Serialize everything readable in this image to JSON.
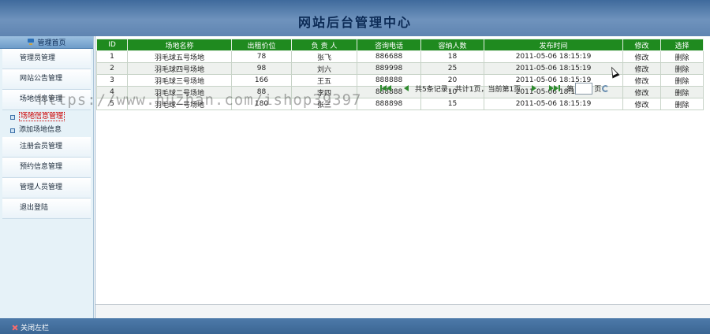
{
  "header": {
    "title": "网站后台管理中心"
  },
  "sidebar": {
    "home_label": "管理首页",
    "items": [
      {
        "label": "管理员管理"
      },
      {
        "label": "网站公告管理"
      },
      {
        "label": "场地信息管理"
      }
    ],
    "subitems": [
      {
        "label": "场地信息管理",
        "active": true
      },
      {
        "label": "添加场地信息",
        "active": false
      }
    ],
    "items2": [
      {
        "label": "注册会员管理"
      },
      {
        "label": "预约信息管理"
      },
      {
        "label": "管理人员管理"
      },
      {
        "label": "退出登陆"
      }
    ]
  },
  "table": {
    "columns": [
      "ID",
      "场地名称",
      "出租价位",
      "负 责 人",
      "咨询电话",
      "容纳人数",
      "发布时间",
      "修改",
      "选择"
    ],
    "rows": [
      [
        "1",
        "羽毛球五号场地",
        "78",
        "张飞",
        "886688",
        "18",
        "2011-05-06 18:15:19",
        "修改",
        "删除"
      ],
      [
        "2",
        "羽毛球四号场地",
        "98",
        "刘六",
        "889998",
        "25",
        "2011-05-06 18:15:19",
        "修改",
        "删除"
      ],
      [
        "3",
        "羽毛球三号场地",
        "166",
        "王五",
        "888888",
        "20",
        "2011-05-06 18:15:19",
        "修改",
        "删除"
      ],
      [
        "4",
        "羽毛球二号场地",
        "88",
        "李四",
        "888888",
        "10",
        "2011-05-06 18:15:19",
        "修改",
        "删除"
      ],
      [
        "5",
        "羽毛球一号场地",
        "180",
        "张三",
        "888898",
        "15",
        "2011-05-06 18:15:19",
        "修改",
        "删除"
      ]
    ]
  },
  "pager": {
    "info": "共5条记录，共计1页，当前第1页",
    "goto_label": "第",
    "page_label": "页"
  },
  "footer": {
    "close_label": "关闭左栏"
  },
  "watermark": "https://www.huzhan.com/ishop39397"
}
